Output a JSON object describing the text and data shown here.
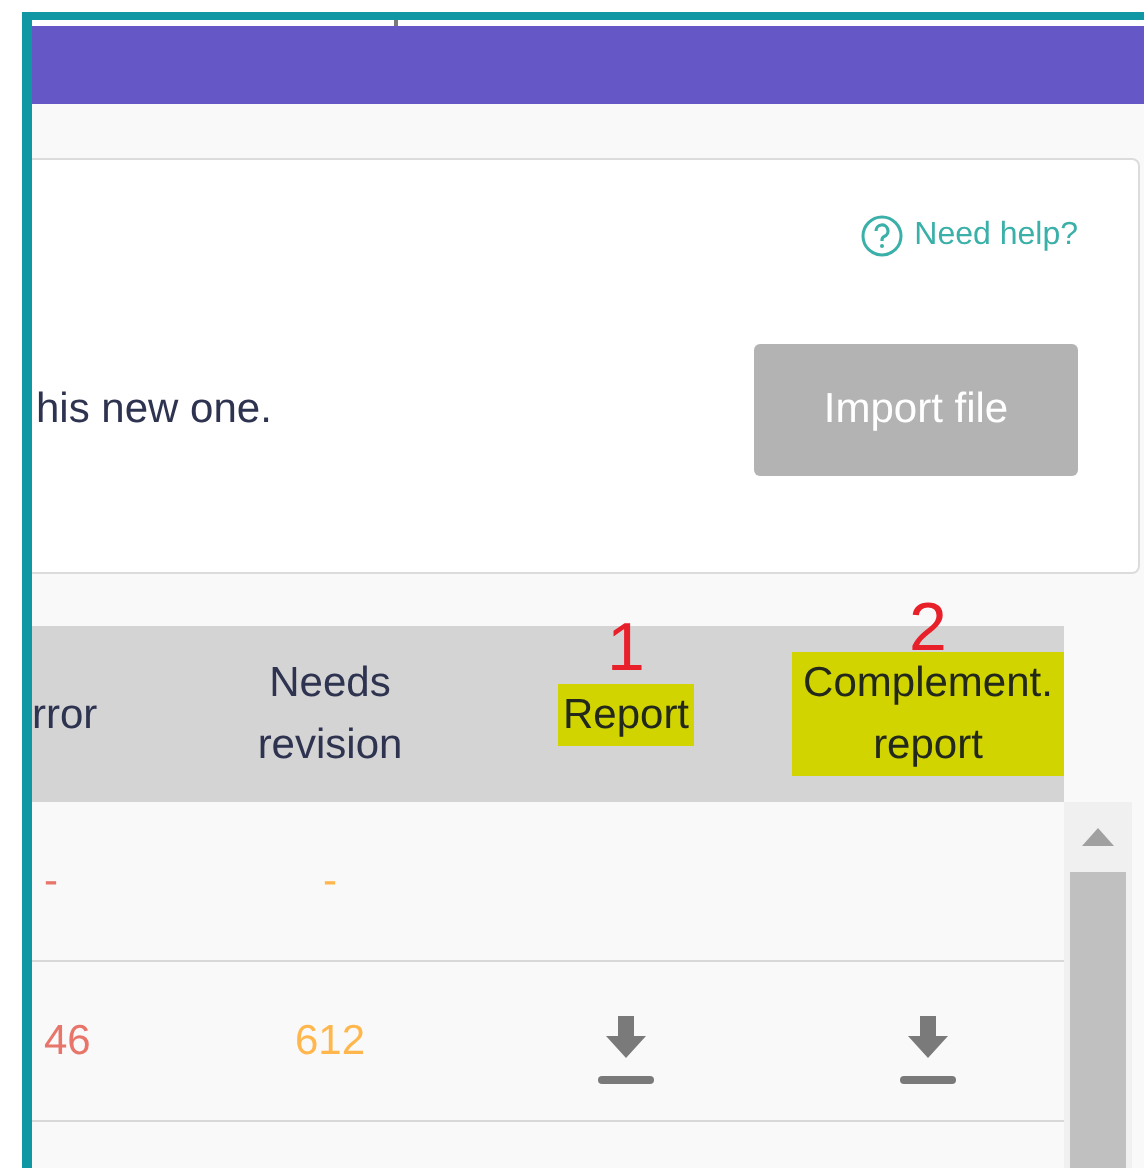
{
  "help_link": "Need help?",
  "description": "his new one.",
  "import_button": {
    "label": "Import file",
    "disabled": true
  },
  "table": {
    "columns": [
      {
        "label": "rror",
        "highlighted": false
      },
      {
        "label": "Needs revision",
        "highlighted": false
      },
      {
        "label": "Report",
        "highlighted": true,
        "annotation": "1"
      },
      {
        "label": "Complement. report",
        "highlighted": true,
        "annotation": "2"
      }
    ],
    "rows": [
      {
        "cells": [
          {
            "kind": "text",
            "text": "-",
            "color": "#e8756a"
          },
          {
            "kind": "text",
            "text": "-",
            "color": "#ffb74d"
          },
          {
            "kind": "empty"
          },
          {
            "kind": "empty"
          }
        ]
      },
      {
        "cells": [
          {
            "kind": "text",
            "text": "46",
            "color": "#e8756a"
          },
          {
            "kind": "text",
            "text": "612",
            "color": "#ffb74d"
          },
          {
            "kind": "download"
          },
          {
            "kind": "download"
          }
        ]
      },
      {
        "cells": [
          {
            "kind": "empty"
          },
          {
            "kind": "empty"
          },
          {
            "kind": "empty"
          },
          {
            "kind": "empty"
          }
        ]
      }
    ]
  }
}
